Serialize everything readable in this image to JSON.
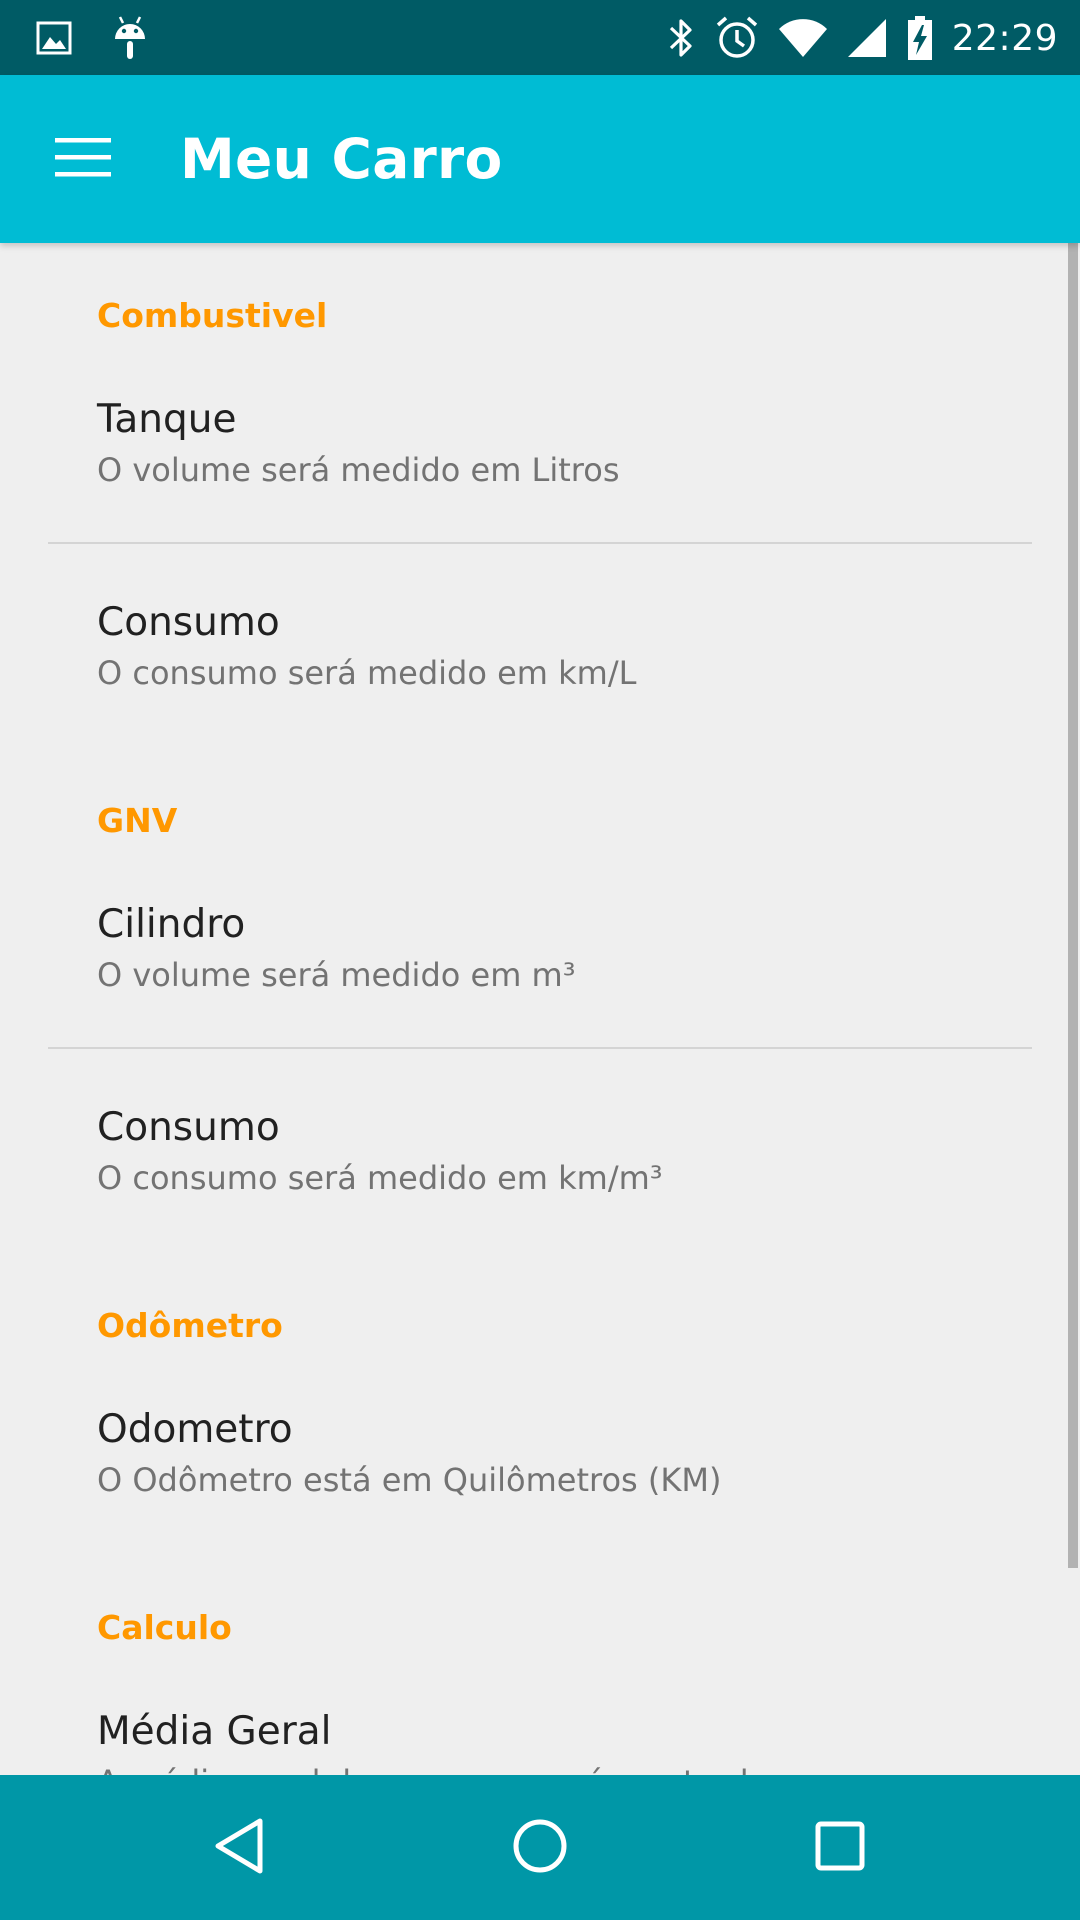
{
  "status_bar": {
    "time": "22:29",
    "left_icons": [
      "image-icon",
      "android-icon"
    ],
    "right_icons": [
      "bluetooth-icon",
      "alarm-icon",
      "wifi-icon",
      "cell-signal-icon",
      "battery-charging-icon"
    ]
  },
  "app_bar": {
    "title": "Meu Carro",
    "color": "#00bcd4"
  },
  "sections": [
    {
      "category": "Combustivel",
      "items": [
        {
          "title": "Tanque",
          "summary": "O volume será medido em Litros"
        },
        {
          "title": "Consumo",
          "summary": "O consumo será medido em km/L"
        }
      ]
    },
    {
      "category": "GNV",
      "items": [
        {
          "title": "Cilindro",
          "summary": "O volume será medido em m³"
        },
        {
          "title": "Consumo",
          "summary": "O consumo será medido em km/m³"
        }
      ]
    },
    {
      "category": "Odômetro",
      "items": [
        {
          "title": "Odometro",
          "summary": "O Odômetro está em Quilômetros (KM)"
        }
      ]
    },
    {
      "category": "Calculo",
      "items": [
        {
          "title": "Média Geral",
          "summary": "A média geral de consumo será mostrada"
        }
      ]
    }
  ],
  "colors": {
    "accent": "#ff9800",
    "status_bar": "#005b65",
    "nav_bar": "#0097a7",
    "background": "#efefef"
  },
  "nav_bar": {
    "buttons": [
      "back-icon",
      "home-icon",
      "recents-icon"
    ]
  }
}
